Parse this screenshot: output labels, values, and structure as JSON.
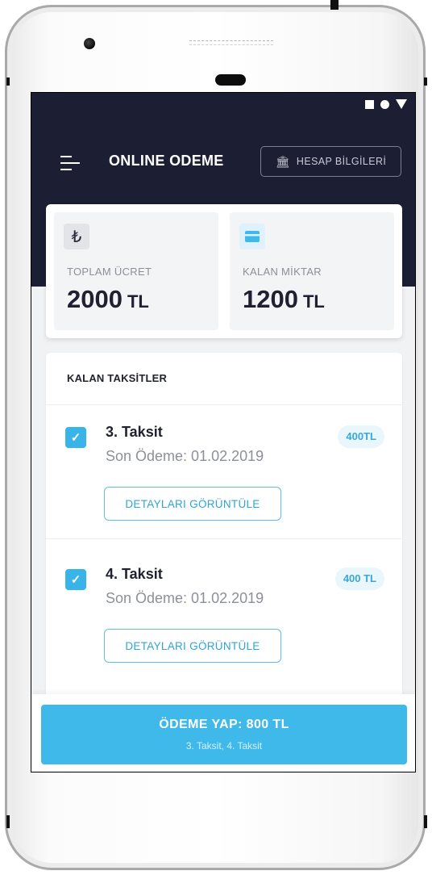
{
  "header": {
    "title": "ONLINE ODEME",
    "bank_button_label": "HESAP BİLGİLERİ"
  },
  "summary": {
    "total": {
      "icon": "lira-icon",
      "label": "TOPLAM ÜCRET",
      "amount": "2000",
      "currency": "TL"
    },
    "remaining": {
      "icon": "credit-card-icon",
      "label": "KALAN MİKTAR",
      "amount": "1200",
      "currency": "TL"
    }
  },
  "installments": {
    "title": "KALAN TAKSİTLER",
    "items": [
      {
        "title": "3. Taksit",
        "due": "Son Ödeme: 01.02.2019",
        "badge": "400TL",
        "checked": true,
        "button": "DETAYLARI GÖRÜNTÜLE"
      },
      {
        "title": "4. Taksit",
        "due": "Son Ödeme: 01.02.2019",
        "badge": "400 TL",
        "checked": true,
        "button": "DETAYLARI GÖRÜNTÜLE"
      }
    ]
  },
  "pay": {
    "label": "ÖDEME YAP: 800 TL",
    "subtitle": "3. Taksit, 4. Taksit"
  },
  "colors": {
    "header": "#1c1e33",
    "accent": "#3fb9ea",
    "lira_icon_bg": "#e3e4e8",
    "card_icon_bg": "#dff1fb"
  }
}
